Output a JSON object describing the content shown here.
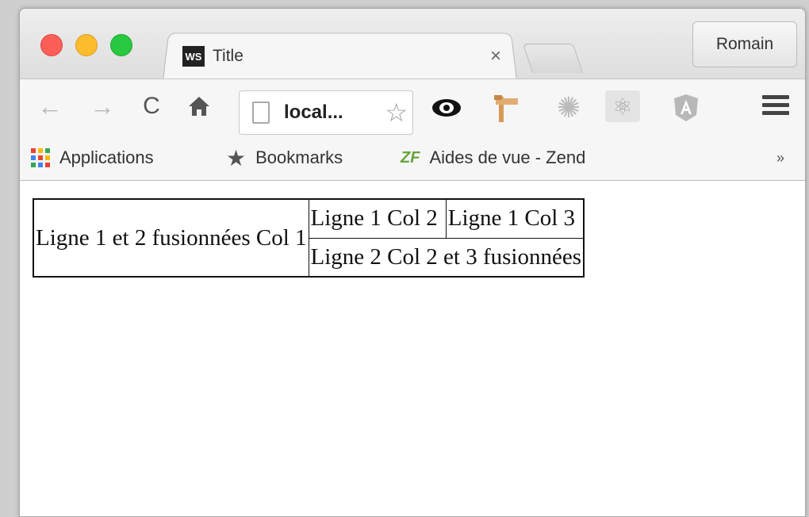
{
  "window": {
    "tab_title": "Title",
    "tab_close": "×",
    "tab_favicon": "WS",
    "profile_button": "Romain"
  },
  "toolbar": {
    "back_glyph": "←",
    "forward_glyph": "→",
    "reload_glyph": "C",
    "home_glyph": "🏠",
    "address_text": "local...",
    "bookmark_star_glyph": "☆"
  },
  "extensions": [
    {
      "name": "eye-extension",
      "icon": "eye-icon"
    },
    {
      "name": "sign-extension",
      "icon": "signpost-icon"
    },
    {
      "name": "gear-extension",
      "icon": "gear-icon"
    },
    {
      "name": "atom-extension",
      "icon": "atom-icon"
    },
    {
      "name": "angular-extension",
      "icon": "angular-icon"
    }
  ],
  "bookmarks": {
    "apps_label": "Applications",
    "bookmarks_label": "Bookmarks",
    "zend_label": "Aides de vue - Zend",
    "more_label": "»",
    "zf_badge": "ZF"
  },
  "table": {
    "cell_merged_col1": "Ligne 1 et 2 fusionnées Col 1",
    "row1_col2": "Ligne 1 Col 2",
    "row1_col3": "Ligne 1 Col 3",
    "row2_col23": "Ligne 2 Col 2 et 3 fusionnées"
  },
  "colors": {
    "traffic_red": "#fc5f57",
    "traffic_yellow": "#fdbc2e",
    "traffic_green": "#28c840",
    "angular_red": "#b5b5b5",
    "zend_green": "#68a33b"
  }
}
